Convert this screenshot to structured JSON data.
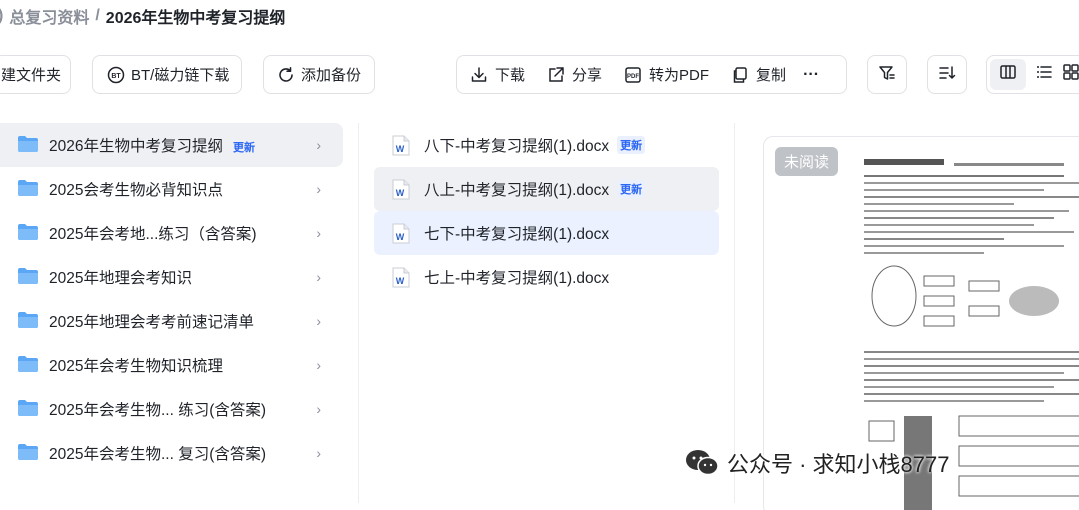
{
  "breadcrumb": {
    "prev_fragment": ")",
    "parent": "总复习资料",
    "separator": "/",
    "current": "2026年生物中考复习提纲"
  },
  "toolbar": {
    "new_folder_label": "建文件夹",
    "bt_label": "BT/磁力链下载",
    "backup_label": "添加备份",
    "download_label": "下载",
    "share_label": "分享",
    "to_pdf_label": "转为PDF",
    "copy_label": "复制",
    "more_label": "···"
  },
  "folders": [
    {
      "name": "2026年生物中考复习提纲",
      "badge": "更新",
      "selected": true
    },
    {
      "name": "2025会考生物必背知识点"
    },
    {
      "name": "2025年会考地...练习（含答案)"
    },
    {
      "name": "2025年地理会考知识"
    },
    {
      "name": "2025年地理会考考前速记清单"
    },
    {
      "name": "2025年会考生物知识梳理"
    },
    {
      "name": "2025年会考生物... 练习(含答案)"
    },
    {
      "name": "2025年会考生物... 复习(含答案)"
    }
  ],
  "files": [
    {
      "name": "八下-中考复习提纲(1).docx",
      "badge": "更新"
    },
    {
      "name": "八上-中考复习提纲(1).docx",
      "badge": "更新"
    },
    {
      "name": "七下-中考复习提纲(1).docx"
    },
    {
      "name": "七上-中考复习提纲(1).docx"
    }
  ],
  "preview": {
    "status": "未阅读"
  },
  "watermark": "公众号 · 求知小栈8777",
  "colors": {
    "accent": "#2b66f5",
    "folder": "#5ba7f5",
    "word_icon": "#2b5fc7"
  },
  "icons": [
    "bt-icon",
    "refresh-icon",
    "download-icon",
    "share-icon",
    "pdf-icon",
    "copy-icon",
    "more-icon",
    "filter-icon",
    "sort-icon",
    "column-view-icon",
    "list-view-icon",
    "grid-view-icon",
    "folder-icon",
    "word-doc-icon",
    "chevron-right-icon",
    "wechat-icon"
  ]
}
